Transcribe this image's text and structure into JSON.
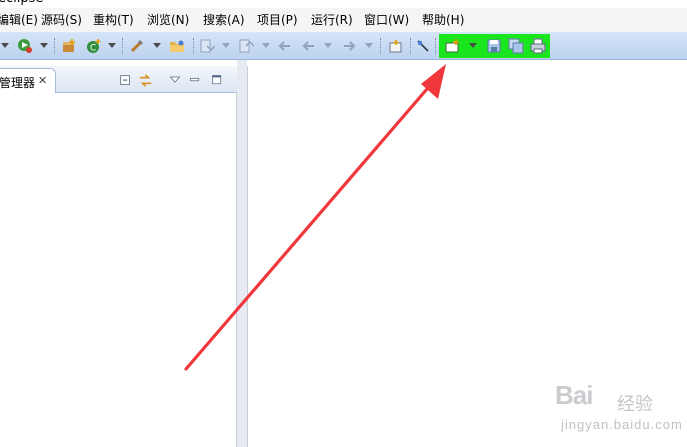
{
  "app": {
    "title": "eclipse"
  },
  "menubar": {
    "items": [
      {
        "label": "编辑(E)"
      },
      {
        "label": "源码(S)"
      },
      {
        "label": "重构(T)"
      },
      {
        "label": "浏览(N)"
      },
      {
        "label": "搜索(A)"
      },
      {
        "label": "项目(P)"
      },
      {
        "label": "运行(R)"
      },
      {
        "label": "窗口(W)"
      },
      {
        "label": "帮助(H)"
      }
    ]
  },
  "toolbar": {
    "highlight_color": "#19e61c",
    "icons": [
      "debug-icon",
      "run-icon",
      "new-package-icon",
      "new-class-icon",
      "open-task-icon",
      "open-folder-icon",
      "next-annotation-icon",
      "prev-annotation-icon",
      "back-icon",
      "back-history-icon",
      "forward-icon",
      "open-perspective-icon",
      "pin-icon",
      "new-file-icon",
      "save-icon",
      "save-all-icon",
      "print-icon"
    ]
  },
  "left_pane": {
    "tab_label": "管理器",
    "close_glyph": "✕"
  },
  "annotation": {
    "arrow_color": "#f0383c"
  },
  "watermark": {
    "logo": "Bai",
    "cn": "经验",
    "sub": "jingyan.baidu.com"
  }
}
